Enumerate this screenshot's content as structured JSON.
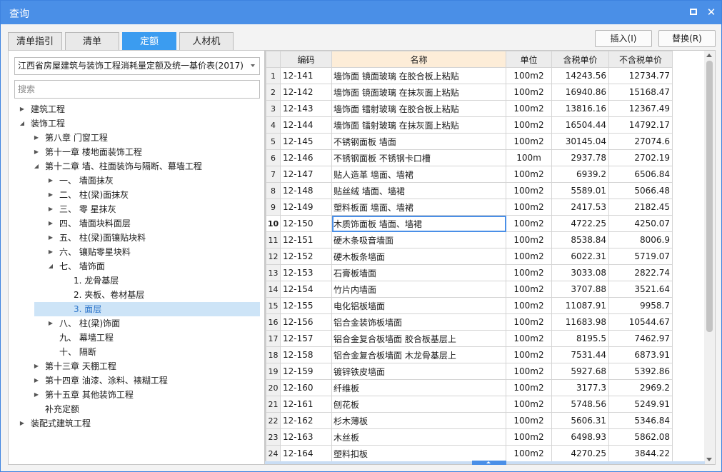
{
  "window": {
    "title": "查询",
    "maximize_icon": "maximize-icon",
    "close_icon": "close-icon",
    "close_glyph": "✕"
  },
  "tabs": [
    {
      "label": "清单指引",
      "active": false
    },
    {
      "label": "清单",
      "active": false
    },
    {
      "label": "定额",
      "active": true
    },
    {
      "label": "人材机",
      "active": false
    }
  ],
  "actions": {
    "insert_label": "插入(I)",
    "replace_label": "替换(R)"
  },
  "left": {
    "library_select": "江西省房屋建筑与装饰工程消耗量定额及统一基价表(2017)",
    "search_placeholder": "搜索",
    "tree": [
      {
        "label": "建筑工程",
        "level": 0,
        "state": "collapsed"
      },
      {
        "label": "装饰工程",
        "level": 0,
        "state": "expanded"
      },
      {
        "label": "第八章 门窗工程",
        "level": 1,
        "state": "collapsed"
      },
      {
        "label": "第十一章 楼地面装饰工程",
        "level": 1,
        "state": "collapsed"
      },
      {
        "label": "第十二章 墙、柱面装饰与隔断、幕墙工程",
        "level": 1,
        "state": "expanded"
      },
      {
        "label": "一、  墙面抹灰",
        "level": 2,
        "state": "collapsed"
      },
      {
        "label": "二、  柱(梁)面抹灰",
        "level": 2,
        "state": "collapsed"
      },
      {
        "label": "三、  零 星抹灰",
        "level": 2,
        "state": "collapsed"
      },
      {
        "label": "四、  墙面块料面层",
        "level": 2,
        "state": "collapsed"
      },
      {
        "label": "五、  柱(梁)面镶贴块料",
        "level": 2,
        "state": "collapsed"
      },
      {
        "label": "六、  镶贴零星块料",
        "level": 2,
        "state": "collapsed"
      },
      {
        "label": "七、  墙饰面",
        "level": 2,
        "state": "expanded"
      },
      {
        "label": "1. 龙骨基层",
        "level": 3,
        "state": "leaf"
      },
      {
        "label": "2. 夹板、卷材基层",
        "level": 3,
        "state": "leaf"
      },
      {
        "label": "3. 面层",
        "level": 3,
        "state": "leaf",
        "selected": true
      },
      {
        "label": "八、  柱(梁)饰面",
        "level": 2,
        "state": "collapsed"
      },
      {
        "label": "九、  幕墙工程",
        "level": 2,
        "state": "leaf"
      },
      {
        "label": "十、  隔断",
        "level": 2,
        "state": "leaf"
      },
      {
        "label": "第十三章 天棚工程",
        "level": 1,
        "state": "collapsed"
      },
      {
        "label": "第十四章 油漆、涂料、裱糊工程",
        "level": 1,
        "state": "collapsed"
      },
      {
        "label": "第十五章 其他装饰工程",
        "level": 1,
        "state": "collapsed"
      },
      {
        "label": "补充定额",
        "level": 1,
        "state": "leaf"
      },
      {
        "label": "装配式建筑工程",
        "level": 0,
        "state": "collapsed"
      }
    ]
  },
  "table": {
    "columns": [
      "编码",
      "名称",
      "单位",
      "含税单价",
      "不含税单价"
    ],
    "current_row": 10,
    "rows": [
      [
        "1",
        "12-141",
        "墙饰面 镜面玻璃 在胶合板上粘贴",
        "100m2",
        "14243.56",
        "12734.77"
      ],
      [
        "2",
        "12-142",
        "墙饰面 镜面玻璃 在抹灰面上粘贴",
        "100m2",
        "16940.86",
        "15168.47"
      ],
      [
        "3",
        "12-143",
        "墙饰面 镭射玻璃 在胶合板上粘贴",
        "100m2",
        "13816.16",
        "12367.49"
      ],
      [
        "4",
        "12-144",
        "墙饰面 镭射玻璃 在抹灰面上粘贴",
        "100m2",
        "16504.44",
        "14792.17"
      ],
      [
        "5",
        "12-145",
        "不锈钢面板 墙面",
        "100m2",
        "30145.04",
        "27074.6"
      ],
      [
        "6",
        "12-146",
        "不锈钢面板 不锈钢卡口槽",
        "100m",
        "2937.78",
        "2702.19"
      ],
      [
        "7",
        "12-147",
        "贴人造革 墙面、墙裙",
        "100m2",
        "6939.2",
        "6506.84"
      ],
      [
        "8",
        "12-148",
        "贴丝绒 墙面、墙裙",
        "100m2",
        "5589.01",
        "5066.48"
      ],
      [
        "9",
        "12-149",
        "塑料板面 墙面、墙裙",
        "100m2",
        "2417.53",
        "2182.45"
      ],
      [
        "10",
        "12-150",
        "木质饰面板 墙面、墙裙",
        "100m2",
        "4722.25",
        "4250.07"
      ],
      [
        "11",
        "12-151",
        "硬木条吸音墙面",
        "100m2",
        "8538.84",
        "8006.9"
      ],
      [
        "12",
        "12-152",
        "硬木板条墙面",
        "100m2",
        "6022.31",
        "5719.07"
      ],
      [
        "13",
        "12-153",
        "石膏板墙面",
        "100m2",
        "3033.08",
        "2822.74"
      ],
      [
        "14",
        "12-154",
        "竹片内墙面",
        "100m2",
        "3707.88",
        "3521.64"
      ],
      [
        "15",
        "12-155",
        "电化铝板墙面",
        "100m2",
        "11087.91",
        "9958.7"
      ],
      [
        "16",
        "12-156",
        "铝合金装饰板墙面",
        "100m2",
        "11683.98",
        "10544.67"
      ],
      [
        "17",
        "12-157",
        "铝合金复合板墙面 胶合板基层上",
        "100m2",
        "8195.5",
        "7462.97"
      ],
      [
        "18",
        "12-158",
        "铝合金复合板墙面 木龙骨基层上",
        "100m2",
        "7531.44",
        "6873.91"
      ],
      [
        "19",
        "12-159",
        "镀锌铁皮墙面",
        "100m2",
        "5927.68",
        "5392.86"
      ],
      [
        "20",
        "12-160",
        "纤维板",
        "100m2",
        "3177.3",
        "2969.2"
      ],
      [
        "21",
        "12-161",
        "刨花板",
        "100m2",
        "5748.56",
        "5249.91"
      ],
      [
        "22",
        "12-162",
        "杉木薄板",
        "100m2",
        "5606.31",
        "5346.84"
      ],
      [
        "23",
        "12-163",
        "木丝板",
        "100m2",
        "6498.93",
        "5862.08"
      ],
      [
        "24",
        "12-164",
        "塑料扣板",
        "100m2",
        "4270.25",
        "3844.22"
      ]
    ]
  },
  "colors": {
    "titlebar": "#4a8fe7",
    "tab_active": "#3b9cf0",
    "selection": "#cde4f7",
    "name_header": "#fdedd8"
  }
}
